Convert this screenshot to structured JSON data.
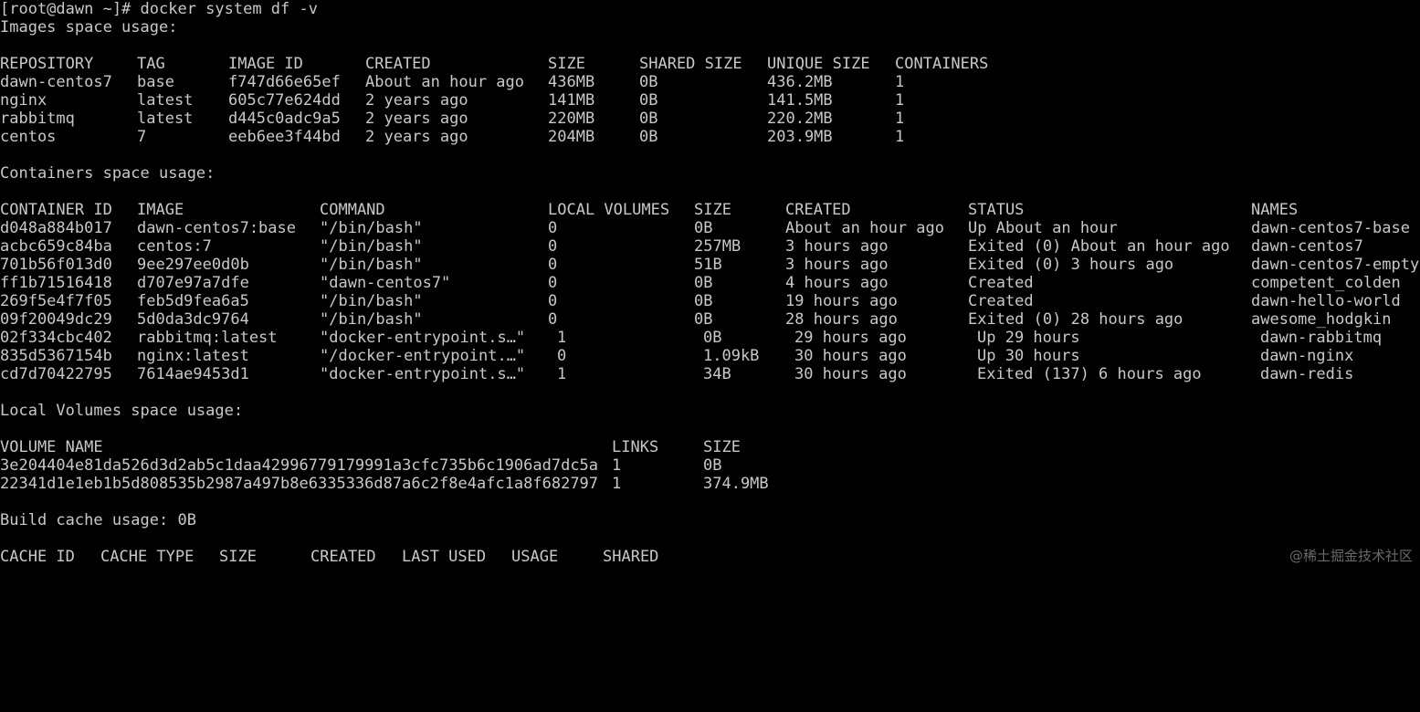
{
  "prompt_line": "[root@dawn ~]# docker system df -v",
  "images_title": "Images space usage:",
  "images_headers": {
    "repository": "REPOSITORY",
    "tag": "TAG",
    "image_id": "IMAGE ID",
    "created": "CREATED",
    "size": "SIZE",
    "shared_size": "SHARED SIZE",
    "unique_size": "UNIQUE SIZE",
    "containers": "CONTAINERS"
  },
  "images": [
    {
      "repository": "dawn-centos7",
      "tag": "base",
      "image_id": "f747d66e65ef",
      "created": "About an hour ago",
      "size": "436MB",
      "shared_size": "0B",
      "unique_size": "436.2MB",
      "containers": "1"
    },
    {
      "repository": "nginx",
      "tag": "latest",
      "image_id": "605c77e624dd",
      "created": "2 years ago",
      "size": "141MB",
      "shared_size": "0B",
      "unique_size": "141.5MB",
      "containers": "1"
    },
    {
      "repository": "rabbitmq",
      "tag": "latest",
      "image_id": "d445c0adc9a5",
      "created": "2 years ago",
      "size": "220MB",
      "shared_size": "0B",
      "unique_size": "220.2MB",
      "containers": "1"
    },
    {
      "repository": "centos",
      "tag": "7",
      "image_id": "eeb6ee3f44bd",
      "created": "2 years ago",
      "size": "204MB",
      "shared_size": "0B",
      "unique_size": "203.9MB",
      "containers": "1"
    }
  ],
  "containers_title": "Containers space usage:",
  "containers_headers": {
    "container_id": "CONTAINER ID",
    "image": "IMAGE",
    "command": "COMMAND",
    "local_volumes": "LOCAL VOLUMES",
    "size": "SIZE",
    "created": "CREATED",
    "status": "STATUS",
    "names": "NAMES"
  },
  "containers": [
    {
      "container_id": "d048a884b017",
      "image": "dawn-centos7:base",
      "command": "\"/bin/bash\"",
      "local_volumes": "0",
      "size": "0B",
      "created": "About an hour ago",
      "status": "Up About an hour",
      "names": "dawn-centos7-base"
    },
    {
      "container_id": "acbc659c84ba",
      "image": "centos:7",
      "command": "\"/bin/bash\"",
      "local_volumes": "0",
      "size": "257MB",
      "created": "3 hours ago",
      "status": "Exited (0) About an hour ago",
      "names": "dawn-centos7"
    },
    {
      "container_id": "701b56f013d0",
      "image": "9ee297ee0d0b",
      "command": "\"/bin/bash\"",
      "local_volumes": "0",
      "size": "51B",
      "created": "3 hours ago",
      "status": "Exited (0) 3 hours ago",
      "names": "dawn-centos7-empty"
    },
    {
      "container_id": "ff1b71516418",
      "image": "d707e97a7dfe",
      "command": "\"dawn-centos7\"",
      "local_volumes": "0",
      "size": "0B",
      "created": "4 hours ago",
      "status": "Created",
      "names": "competent_colden"
    },
    {
      "container_id": "269f5e4f7f05",
      "image": "feb5d9fea6a5",
      "command": "\"/bin/bash\"",
      "local_volumes": "0",
      "size": "0B",
      "created": "19 hours ago",
      "status": "Created",
      "names": "dawn-hello-world"
    },
    {
      "container_id": "09f20049dc29",
      "image": "5d0da3dc9764",
      "command": "\"/bin/bash\"",
      "local_volumes": "0",
      "size": "0B",
      "created": "28 hours ago",
      "status": "Exited (0) 28 hours ago",
      "names": "awesome_hodgkin"
    },
    {
      "container_id": "02f334cbc402",
      "image": "rabbitmq:latest",
      "command": "\"docker-entrypoint.s…\"",
      "local_volumes": "1",
      "size": "0B",
      "created": "29 hours ago",
      "status": "Up 29 hours",
      "names": "dawn-rabbitmq"
    },
    {
      "container_id": "835d5367154b",
      "image": "nginx:latest",
      "command": "\"/docker-entrypoint.…\"",
      "local_volumes": "0",
      "size": "1.09kB",
      "created": "30 hours ago",
      "status": "Up 30 hours",
      "names": "dawn-nginx"
    },
    {
      "container_id": "cd7d70422795",
      "image": "7614ae9453d1",
      "command": "\"docker-entrypoint.s…\"",
      "local_volumes": "1",
      "size": "34B",
      "created": "30 hours ago",
      "status": "Exited (137) 6 hours ago",
      "names": "dawn-redis"
    }
  ],
  "volumes_title": "Local Volumes space usage:",
  "volumes_headers": {
    "volume_name": "VOLUME NAME",
    "links": "LINKS",
    "size": "SIZE"
  },
  "volumes": [
    {
      "volume_name": "3e204404e81da526d3d2ab5c1daa42996779179991a3cfc735b6c1906ad7dc5a",
      "links": "1",
      "size": "0B"
    },
    {
      "volume_name": "22341d1e1eb1b5d808535b2987a497b8e6335336d87a6c2f8e4afc1a8f682797",
      "links": "1",
      "size": "374.9MB"
    }
  ],
  "build_cache_line": "Build cache usage: 0B",
  "cache_headers": {
    "cache_id": "CACHE ID",
    "cache_type": "CACHE TYPE",
    "size": "SIZE",
    "created": "CREATED",
    "last_used": "LAST USED",
    "usage": "USAGE",
    "shared": "SHARED"
  },
  "watermark": "@稀土掘金技术社区",
  "colors": {
    "background": "#000000",
    "foreground": "#c8c8c8",
    "watermark": "#6a6a6a"
  }
}
